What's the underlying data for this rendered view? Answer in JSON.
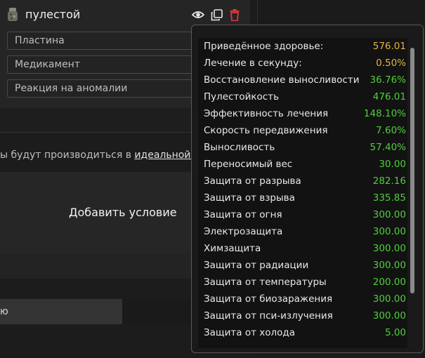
{
  "item": {
    "title": "пулестой",
    "fields": [
      "Пластина",
      "Медикамент",
      "Реакция на аномалии"
    ]
  },
  "note": {
    "prefix": "ы будут производиться в ",
    "link": "идеальной с"
  },
  "add_condition_label": "Добавить условие",
  "bottom_input_text": "ю",
  "colors": {
    "positive": "#4fcf3c",
    "warning": "#e3b341",
    "delete": "#e0393e"
  },
  "stats": [
    {
      "name": "Приведённое здоровье:",
      "value": "576.01",
      "tone": "warning"
    },
    {
      "name": "Лечение в секунду:",
      "value": "0.50%",
      "tone": "warning"
    },
    {
      "name": "Восстановление выносливости",
      "value": "36.76%",
      "tone": "positive"
    },
    {
      "name": "Пулестойкость",
      "value": "476.01",
      "tone": "positive"
    },
    {
      "name": "Эффективность лечения",
      "value": "148.10%",
      "tone": "positive"
    },
    {
      "name": "Скорость передвижения",
      "value": "7.60%",
      "tone": "positive"
    },
    {
      "name": "Выносливость",
      "value": "57.40%",
      "tone": "positive"
    },
    {
      "name": "Переносимый вес",
      "value": "30.00",
      "tone": "positive"
    },
    {
      "name": "Защита от разрыва",
      "value": "282.16",
      "tone": "positive"
    },
    {
      "name": "Защита от взрыва",
      "value": "335.85",
      "tone": "positive"
    },
    {
      "name": "Защита от огня",
      "value": "300.00",
      "tone": "positive"
    },
    {
      "name": "Электрозащита",
      "value": "300.00",
      "tone": "positive"
    },
    {
      "name": "Химзащита",
      "value": "300.00",
      "tone": "positive"
    },
    {
      "name": "Защита от радиации",
      "value": "300.00",
      "tone": "positive"
    },
    {
      "name": "Защита от температуры",
      "value": "200.00",
      "tone": "positive"
    },
    {
      "name": "Защита от биозаражения",
      "value": "300.00",
      "tone": "positive"
    },
    {
      "name": "Защита от пси-излучения",
      "value": "300.00",
      "tone": "positive"
    },
    {
      "name": "Защита от холода",
      "value": "5.00",
      "tone": "positive"
    }
  ]
}
